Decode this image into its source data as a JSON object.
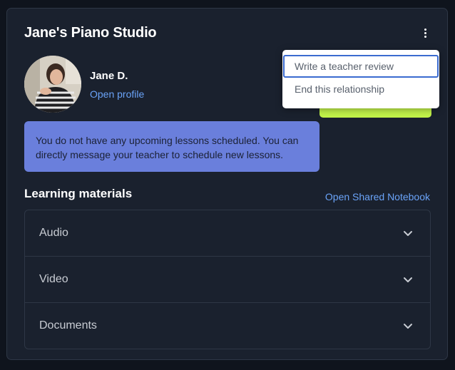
{
  "studio": {
    "title": "Jane's Piano Studio",
    "more_options_icon": "kebab-menu-icon"
  },
  "teacher": {
    "name": "Jane D.",
    "profile_link": "Open profile"
  },
  "notice": {
    "text": "You do not have any upcoming lessons scheduled. You can directly message your teacher to schedule new lessons."
  },
  "materials": {
    "title": "Learning materials",
    "notebook_link": "Open Shared Notebook",
    "items": [
      {
        "label": "Audio"
      },
      {
        "label": "Video"
      },
      {
        "label": "Documents"
      }
    ]
  },
  "menu": {
    "items": [
      {
        "label": "Write a teacher review",
        "focused": true
      },
      {
        "label": "End this relationship",
        "focused": false
      }
    ]
  },
  "colors": {
    "background": "#0f141d",
    "card": "#1a212e",
    "border": "#2e3746",
    "link": "#6aa3f8",
    "notice": "#6a7fdc",
    "accent_button": "#c2f44a",
    "focus_ring": "#3a6bd0"
  }
}
